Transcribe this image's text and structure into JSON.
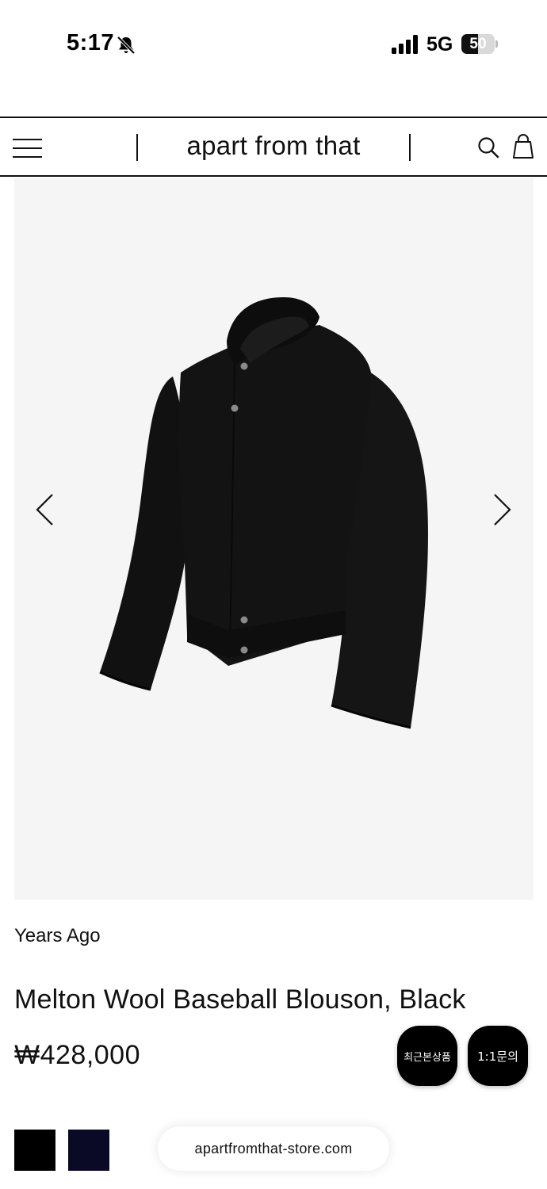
{
  "status_bar": {
    "time": "5:17",
    "network": "5G",
    "battery_level": "50",
    "battery_fraction": 0.5,
    "icons": [
      "bell-slash-icon",
      "signal-bars-icon",
      "battery-icon"
    ]
  },
  "header": {
    "brand_logo": "apart from that",
    "icons": [
      "menu-icon",
      "search-icon",
      "shopping-bag-icon"
    ]
  },
  "gallery": {
    "image_subject": "black wool baseball blouson jacket",
    "icons": [
      "chevron-left-icon",
      "chevron-right-icon"
    ]
  },
  "product": {
    "brand": "Years Ago",
    "title": "Melton Wool Baseball Blouson, Black",
    "price": "₩428,000"
  },
  "floating_buttons": {
    "recent_viewed": "최근본상품",
    "inquiry": "1:1문의"
  },
  "swatches": [
    {
      "name": "black",
      "color": "#000000"
    },
    {
      "name": "navy",
      "color": "#0a0a26"
    }
  ],
  "browser": {
    "url": "apartfromthat-store.com"
  },
  "colors": {
    "background": "#ffffff",
    "gallery_background": "#f5f5f5",
    "text": "#111111",
    "button": "#000000"
  }
}
